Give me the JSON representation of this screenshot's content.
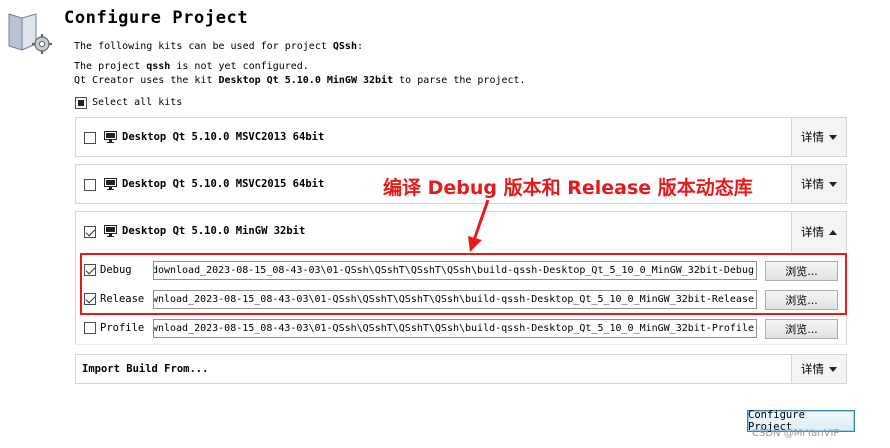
{
  "header": {
    "title": "Configure Project",
    "icon": "folder-gear-icon"
  },
  "info": {
    "kits_intro_prefix": "The following kits can be used for project ",
    "project_name": "QSsh",
    "kits_intro_suffix": ":",
    "not_configured_prefix": "The project ",
    "project_file": "qssh",
    "not_configured_suffix": " is not yet configured.",
    "parse_prefix": "Qt Creator uses the kit ",
    "parse_kit": "Desktop Qt 5.10.0 MinGW 32bit",
    "parse_suffix": " to parse the project."
  },
  "select_all": {
    "label": "Select all kits",
    "state": "partial"
  },
  "kits": [
    {
      "name": "Desktop Qt 5.10.0 MSVC2013 64bit",
      "checked": false,
      "details_label": "详情",
      "expanded": false
    },
    {
      "name": "Desktop Qt 5.10.0 MSVC2015 64bit",
      "checked": false,
      "details_label": "详情",
      "expanded": false
    },
    {
      "name": "Desktop Qt 5.10.0 MinGW 32bit",
      "checked": true,
      "details_label": "详情",
      "expanded": true
    }
  ],
  "build_configs": [
    {
      "label": "Debug",
      "checked": true,
      "path": "download_2023-08-15_08-43-03\\01-QSsh\\QSshT\\QSshT\\QSsh\\build-qssh-Desktop_Qt_5_10_0_MinGW_32bit-Debug",
      "browse_label": "浏览..."
    },
    {
      "label": "Release",
      "checked": true,
      "path": "wnload_2023-08-15_08-43-03\\01-QSsh\\QSshT\\QSshT\\QSsh\\build-qssh-Desktop_Qt_5_10_0_MinGW_32bit-Release",
      "browse_label": "浏览..."
    },
    {
      "label": "Profile",
      "checked": false,
      "path": "wnload_2023-08-15_08-43-03\\01-QSsh\\QSshT\\QSshT\\QSsh\\build-qssh-Desktop_Qt_5_10_0_MinGW_32bit-Profile",
      "browse_label": "浏览..."
    }
  ],
  "import_build": {
    "label": "Import Build From...",
    "details_label": "详情"
  },
  "annotation": {
    "text": "编译 Debug 版本和 Release 版本动态库",
    "color": "#e8191a"
  },
  "footer": {
    "configure_label": "Configure Project",
    "watermark": "CSDN @MrYanVIP"
  }
}
